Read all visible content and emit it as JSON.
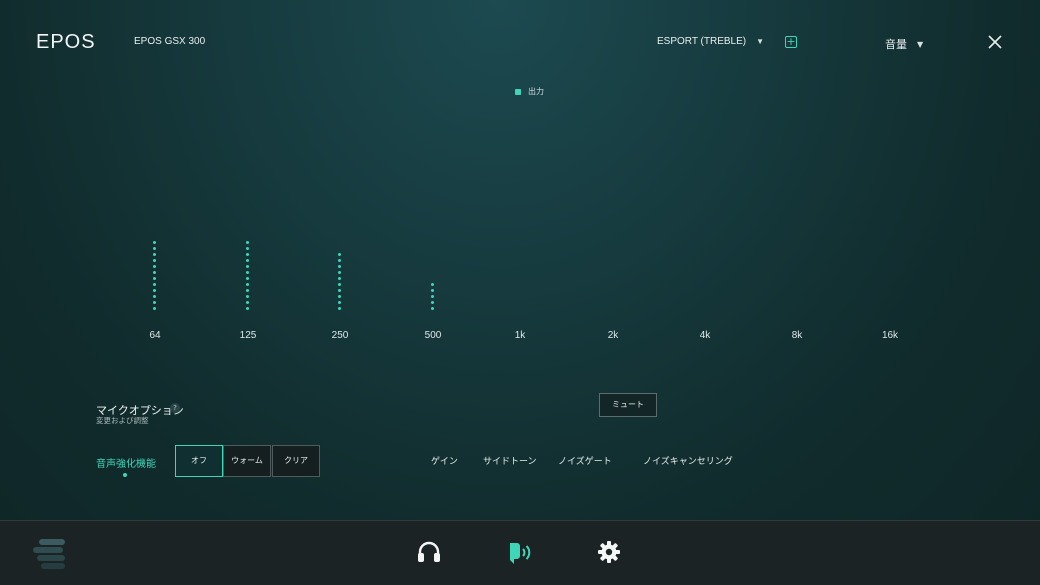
{
  "header": {
    "logo": "EPOS",
    "device": "EPOS GSX 300",
    "preset": "ESPORT (TREBLE)",
    "mode": "音量"
  },
  "legend": {
    "label": "出力",
    "color": "#3fd5b8"
  },
  "equalizer": {
    "bands": [
      {
        "label": "64",
        "level": 12
      },
      {
        "label": "125",
        "level": 12
      },
      {
        "label": "250",
        "level": 10
      },
      {
        "label": "500",
        "level": 5
      },
      {
        "label": "1k",
        "level": 0
      },
      {
        "label": "2k",
        "level": 0
      },
      {
        "label": "4k",
        "level": 0
      },
      {
        "label": "8k",
        "level": 0
      },
      {
        "label": "16k",
        "level": 0
      }
    ]
  },
  "mic": {
    "title": "マイクオプション",
    "help": "?",
    "subtitle": "変更および調整",
    "mute_label": "ミュート",
    "enhancement_label": "音声強化機能",
    "options": [
      {
        "label": "オフ",
        "active": true
      },
      {
        "label": "ウォーム",
        "active": false
      },
      {
        "label": "クリア",
        "active": false
      }
    ],
    "tabs": [
      "ゲイン",
      "サイドトーン",
      "ノイズゲート",
      "ノイズキャンセリング"
    ]
  },
  "colors": {
    "accent": "#3fd5b8"
  }
}
